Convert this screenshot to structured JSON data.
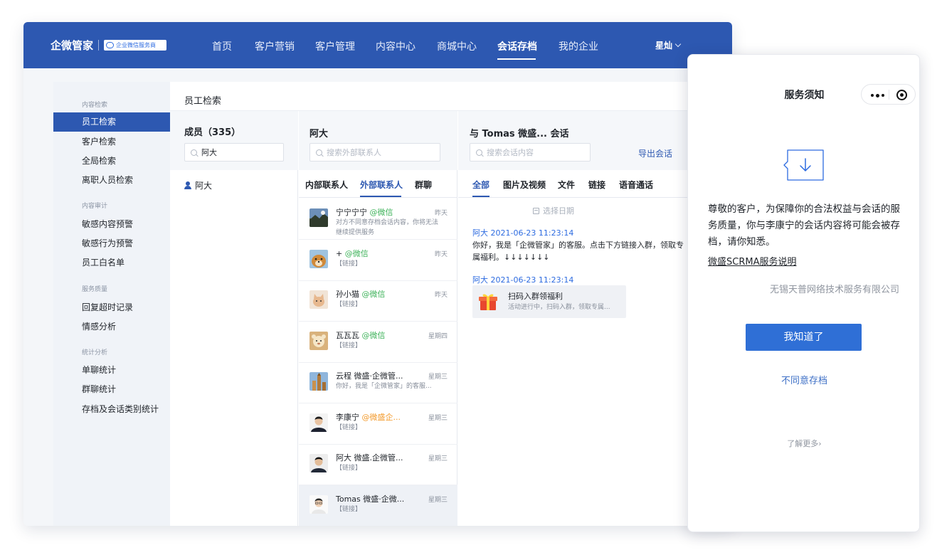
{
  "header": {
    "brand": "企微管家",
    "badge": "企业微信服务商",
    "nav": [
      "首页",
      "客户营销",
      "客户管理",
      "内容中心",
      "商城中心",
      "会话存档",
      "我的企业"
    ],
    "active_nav": "会话存档",
    "user": "星灿"
  },
  "sidebar": {
    "groups": [
      {
        "title": "内容检索",
        "items": [
          "员工检索",
          "客户检索",
          "全局检索",
          "离职人员检索"
        ]
      },
      {
        "title": "内容审计",
        "items": [
          "敏感内容预警",
          "敏感行为预警",
          "员工白名单"
        ]
      },
      {
        "title": "服务质量",
        "items": [
          "回复超时记录",
          "情感分析"
        ]
      },
      {
        "title": "统计分析",
        "items": [
          "单聊统计",
          "群聊统计",
          "存档及会话类别统计"
        ]
      }
    ],
    "active_item": "员工检索"
  },
  "main": {
    "title": "员工检索",
    "members": {
      "heading": "成员（335）",
      "search_value": "阿大",
      "results": [
        "阿大"
      ]
    },
    "contacts": {
      "heading": "阿大",
      "search_placeholder": "搜索外部联系人",
      "tabs": [
        "内部联系人",
        "外部联系人",
        "群聊"
      ],
      "active_tab": "外部联系人",
      "list": [
        {
          "name": "宁宁宁宁",
          "tag": "@微信",
          "tag_color": "green",
          "sub": "对方不同意存档会话内容，你将无法继续提供服务",
          "time": "昨天",
          "avatar": "photo"
        },
        {
          "name": "+",
          "tag": "@微信",
          "tag_color": "green",
          "sub": "【链接】",
          "time": "昨天",
          "avatar": "dog"
        },
        {
          "name": "孙小猫",
          "tag": "@微信",
          "tag_color": "green",
          "sub": "【链接】",
          "time": "昨天",
          "avatar": "cat"
        },
        {
          "name": "瓦瓦瓦",
          "tag": "@微信",
          "tag_color": "green",
          "sub": "【链接】",
          "time": "星期四",
          "avatar": "bear"
        },
        {
          "name": "云程 微盛·企微管...",
          "tag": "",
          "tag_color": "",
          "sub": "你好，我是「企微管家」的客服...",
          "time": "星期三",
          "avatar": "city"
        },
        {
          "name": "李康宁",
          "tag": "@微盛企...",
          "tag_color": "orange",
          "sub": "【链接】",
          "time": "星期三",
          "avatar": "man1"
        },
        {
          "name": "阿大 微盛.企微管...",
          "tag": "",
          "tag_color": "",
          "sub": "【链接】",
          "time": "星期三",
          "avatar": "man2"
        },
        {
          "name": "Tomas 微盛·企微...",
          "tag": "",
          "tag_color": "",
          "sub": "【链接】",
          "time": "星期三",
          "avatar": "man3"
        }
      ],
      "selected_index": 7
    },
    "chat": {
      "heading": "与 Tomas 微盛... 会话",
      "search_placeholder": "搜索会话内容",
      "export_label": "导出会话",
      "tabs": [
        "全部",
        "图片及视频",
        "文件",
        "链接",
        "语音通话"
      ],
      "active_tab": "全部",
      "date_pick": "选择日期",
      "messages": [
        {
          "meta": "阿大 2021-06-23 11:23:14",
          "text": "你好，我是「企微管家」的客服。点击下方链接入群，领取专属福利。↓↓↓↓↓↓↓"
        },
        {
          "meta": "阿大 2021-06-23 11:23:14",
          "card_title": "扫码入群领福利",
          "card_sub": "活动进行中，扫码入群，领取专属..."
        }
      ]
    }
  },
  "dialog": {
    "title": "服务须知",
    "notice": "尊敬的客户，为保障你的合法权益与会话的服务质量，你与李康宁的会话内容将可能会被存档，请你知悉。",
    "link": "微盛SCRMA服务说明",
    "company": "无锡天普网络技术服务有限公司",
    "confirm": "我知道了",
    "decline": "不同意存档",
    "learn_more": "了解更多›"
  }
}
